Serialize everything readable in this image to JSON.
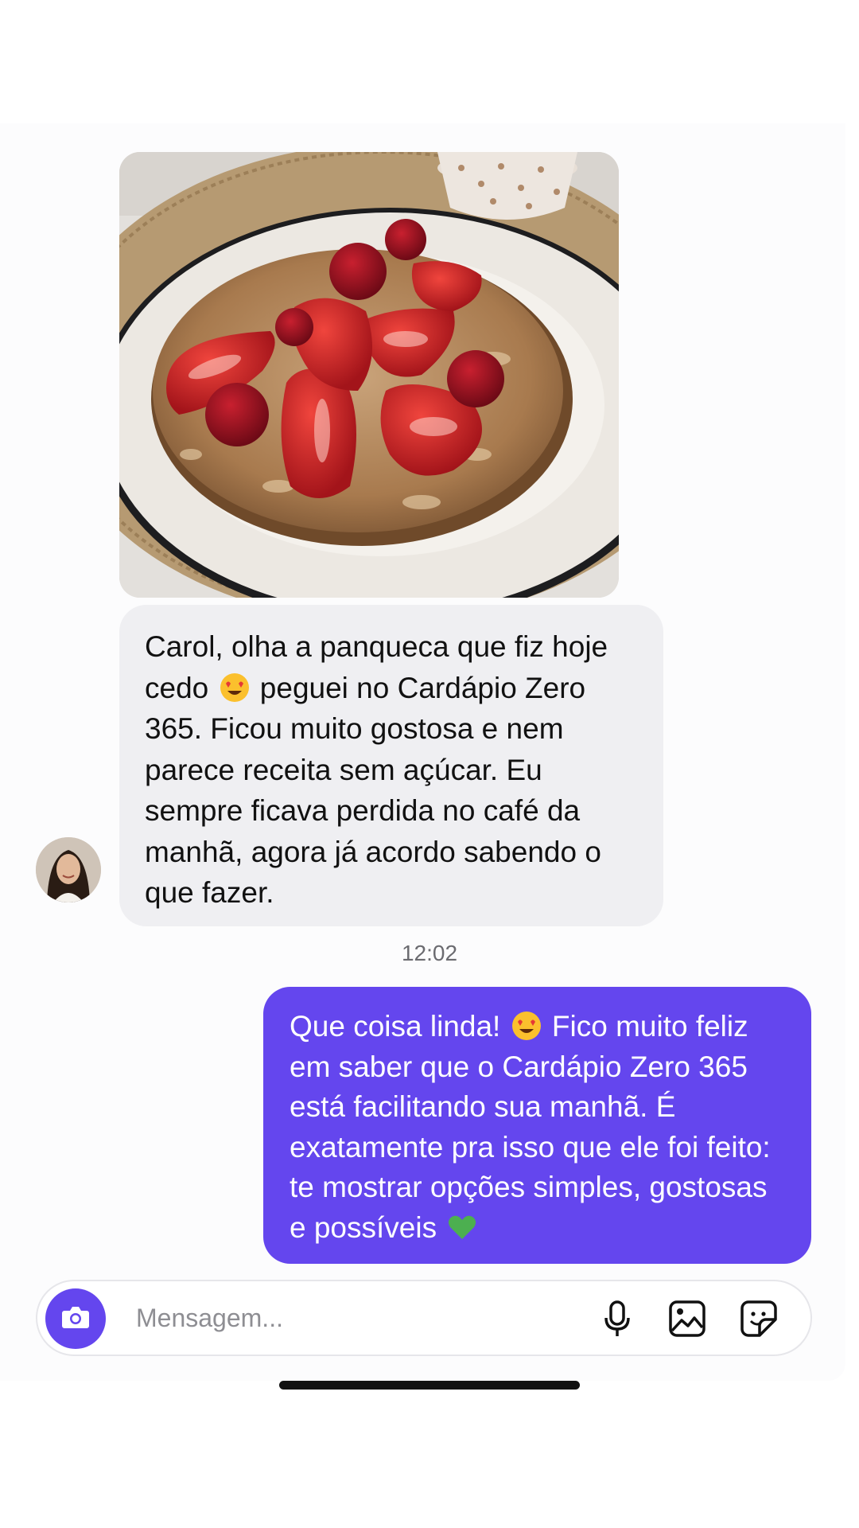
{
  "conversation": {
    "incoming": {
      "photo_description_icon": "pancake-photo",
      "text_before_emoji": "Carol, olha a panqueca que fiz hoje cedo",
      "emoji": "heart-eyes-emoji",
      "text_after_emoji": "peguei no Cardápio Zero 365. Ficou muito gostosa e nem parece receita sem açúcar. Eu sempre ficava perdida no café da manhã, agora já acordo sabendo o que fazer."
    },
    "timestamp": "12:02",
    "outgoing": {
      "text_before_emoji": "Que coisa linda!",
      "emoji": "heart-eyes-emoji",
      "text_middle": "Fico muito feliz em saber que o Cardápio Zero 365 está facilitando sua manhã. É exatamente pra isso que ele foi feito: te mostrar opções simples, gostosas e possíveis",
      "end_emoji": "green-heart-emoji"
    }
  },
  "composer": {
    "placeholder": "Mensagem...",
    "camera_icon": "camera-icon",
    "mic_icon": "microphone-icon",
    "gallery_icon": "gallery-icon",
    "sticker_icon": "sticker-icon"
  },
  "colors": {
    "accent": "#6446ee",
    "incoming_bubble": "#efeff2",
    "background": "#fcfcfd"
  }
}
